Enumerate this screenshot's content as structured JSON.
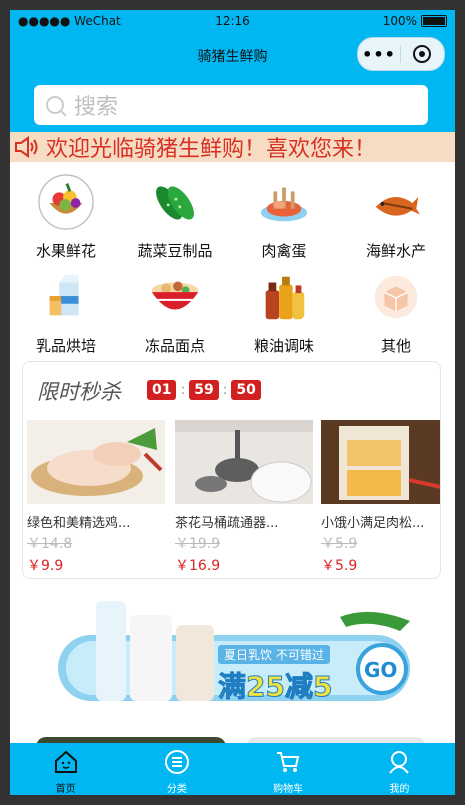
{
  "status": {
    "carrier": "●●●●● WeChat",
    "time": "12:16",
    "battery": "100%"
  },
  "nav": {
    "title": "骑猪生鲜购",
    "more": "•••"
  },
  "search": {
    "placeholder": "搜索"
  },
  "notice": {
    "text": "欢迎光临骑猪生鲜购！喜欢您来！"
  },
  "categories": [
    {
      "label": "水果鲜花",
      "icon": "fruit-basket-icon"
    },
    {
      "label": "蔬菜豆制品",
      "icon": "cucumber-icon"
    },
    {
      "label": "肉禽蛋",
      "icon": "meat-plate-icon"
    },
    {
      "label": "海鲜水产",
      "icon": "fish-icon"
    },
    {
      "label": "乳品烘培",
      "icon": "milk-icon"
    },
    {
      "label": "冻品面点",
      "icon": "hotpot-bowl-icon"
    },
    {
      "label": "粮油调味",
      "icon": "sauce-bottles-icon"
    },
    {
      "label": "其他",
      "icon": "box-icon"
    }
  ],
  "flash_sale": {
    "title": "限时秒杀",
    "timer": [
      "01",
      "59",
      "50"
    ],
    "products": [
      {
        "name": "绿色和美精选鸡...",
        "old_price": "￥14.8",
        "price": "￥9.9"
      },
      {
        "name": "茶花马桶疏通器...",
        "old_price": "￥19.9",
        "price": "￥16.9"
      },
      {
        "name": "小饿小满足肉松...",
        "old_price": "￥5.9",
        "price": "￥5.9"
      }
    ]
  },
  "banner": {
    "slogan": "夏日乳饮 不可错过",
    "promo": "满25减5",
    "go": "GO"
  },
  "tabbar": [
    {
      "label": "首页",
      "icon": "home-icon"
    },
    {
      "label": "分类",
      "icon": "category-list-icon"
    },
    {
      "label": "购物车",
      "icon": "cart-icon"
    },
    {
      "label": "我的",
      "icon": "profile-icon"
    }
  ],
  "colors": {
    "brand": "#00b7f2",
    "notice_bg": "#f6dcc2",
    "accent_red": "#d21f1f"
  }
}
